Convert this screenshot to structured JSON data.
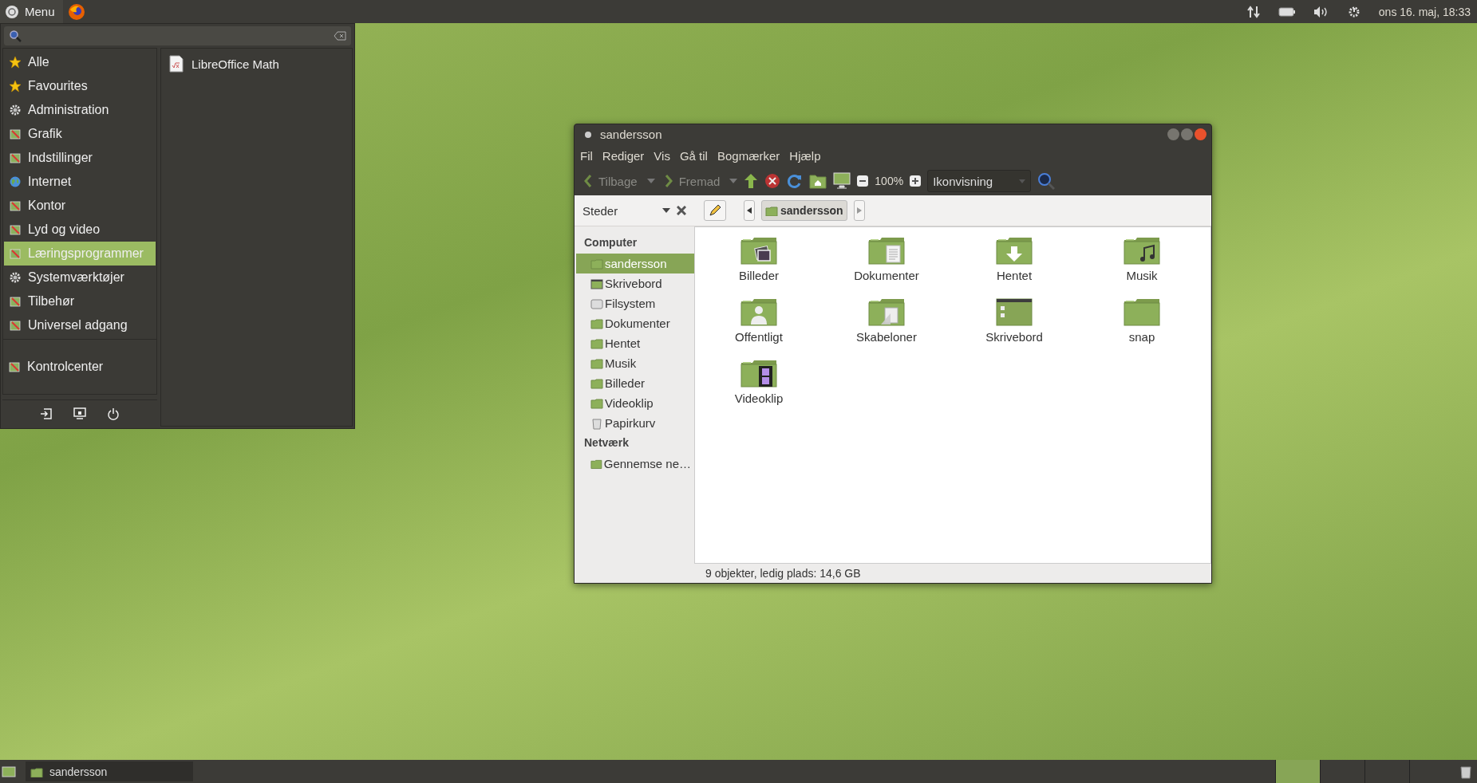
{
  "top_panel": {
    "menu_button": "Menu",
    "clock": "ons 16. maj, 18:33"
  },
  "app_menu": {
    "categories": [
      {
        "label": "Alle",
        "kind": "star",
        "selected": false
      },
      {
        "label": "Favourites",
        "kind": "star",
        "selected": false
      },
      {
        "label": "Administration",
        "kind": "gear",
        "selected": false
      },
      {
        "label": "Grafik",
        "kind": "app",
        "selected": false
      },
      {
        "label": "Indstillinger",
        "kind": "app",
        "selected": false
      },
      {
        "label": "Internet",
        "kind": "globe",
        "selected": false
      },
      {
        "label": "Kontor",
        "kind": "app",
        "selected": false
      },
      {
        "label": "Lyd og video",
        "kind": "app",
        "selected": false
      },
      {
        "label": "Læringsprogrammer",
        "kind": "app",
        "selected": true
      },
      {
        "label": "Systemværktøjer",
        "kind": "gear",
        "selected": false
      },
      {
        "label": "Tilbehør",
        "kind": "app",
        "selected": false
      },
      {
        "label": "Universel adgang",
        "kind": "app",
        "selected": false
      }
    ],
    "control_center": "Kontrolcenter",
    "apps": [
      "LibreOffice Math"
    ]
  },
  "file_manager": {
    "title": "sandersson",
    "menu": [
      "Fil",
      "Rediger",
      "Vis",
      "Gå til",
      "Bogmærker",
      "Hjælp"
    ],
    "toolbar": {
      "back": "Tilbage",
      "forward": "Fremad",
      "zoom": "100%",
      "view": "Ikonvisning"
    },
    "side_pane_title": "Steder",
    "breadcrumb": "sandersson",
    "sidebar": [
      {
        "heading": "Computer",
        "items": [
          {
            "label": "sandersson",
            "kind": "home",
            "selected": true
          },
          {
            "label": "Skrivebord",
            "kind": "desktop",
            "selected": false
          },
          {
            "label": "Filsystem",
            "kind": "drive",
            "selected": false
          },
          {
            "label": "Dokumenter",
            "kind": "folder",
            "selected": false
          },
          {
            "label": "Hentet",
            "kind": "download",
            "selected": false
          },
          {
            "label": "Musik",
            "kind": "music",
            "selected": false
          },
          {
            "label": "Billeder",
            "kind": "pictures",
            "selected": false
          },
          {
            "label": "Videoklip",
            "kind": "video",
            "selected": false
          },
          {
            "label": "Papirkurv",
            "kind": "trash",
            "selected": false
          }
        ]
      },
      {
        "heading": "Netværk",
        "items": [
          {
            "label": "Gennemse ne…",
            "kind": "network",
            "selected": false
          }
        ]
      }
    ],
    "files": [
      {
        "name": "Billeder",
        "kind": "pictures"
      },
      {
        "name": "Dokumenter",
        "kind": "documents"
      },
      {
        "name": "Hentet",
        "kind": "download"
      },
      {
        "name": "Musik",
        "kind": "music"
      },
      {
        "name": "Offentligt",
        "kind": "public"
      },
      {
        "name": "Skabeloner",
        "kind": "templates"
      },
      {
        "name": "Skrivebord",
        "kind": "desktop"
      },
      {
        "name": "snap",
        "kind": "folder"
      },
      {
        "name": "Videoklip",
        "kind": "video"
      }
    ],
    "status": "9 objekter, ledig plads: 14,6 GB"
  },
  "bottom_panel": {
    "tasks": [
      "sandersson"
    ],
    "workspaces": [
      {
        "selected": true
      },
      {
        "selected": false
      },
      {
        "selected": false
      },
      {
        "selected": false
      }
    ]
  }
}
